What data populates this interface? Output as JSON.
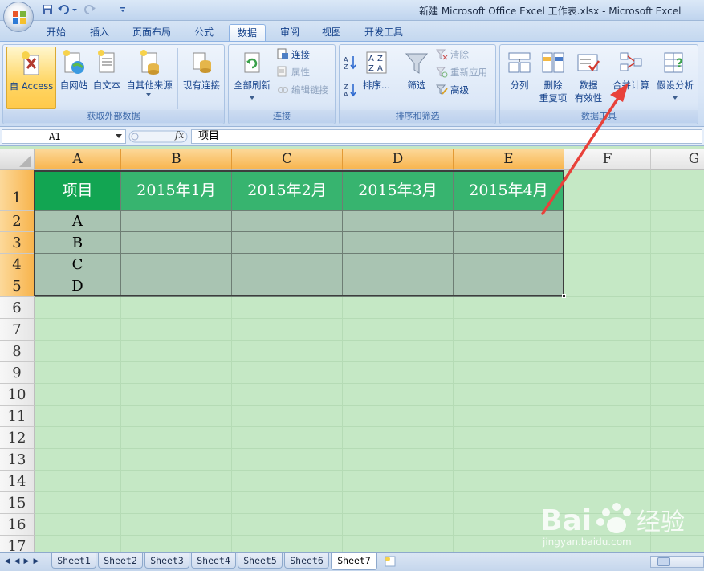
{
  "window": {
    "title": "新建 Microsoft Office Excel 工作表.xlsx - Microsoft Excel"
  },
  "tabs": [
    {
      "label": "开始",
      "active": false
    },
    {
      "label": "插入",
      "active": false
    },
    {
      "label": "页面布局",
      "active": false
    },
    {
      "label": "公式",
      "active": false
    },
    {
      "label": "数据",
      "active": true
    },
    {
      "label": "审阅",
      "active": false
    },
    {
      "label": "视图",
      "active": false
    },
    {
      "label": "开发工具",
      "active": false
    }
  ],
  "ribbon": {
    "get_external": {
      "label": "获取外部数据",
      "access": "自 Access",
      "web": "自网站",
      "text": "自文本",
      "other": "自其他来源",
      "existing": "现有连接"
    },
    "connections": {
      "label": "连接",
      "refresh_all": "全部刷新",
      "connections": "连接",
      "properties": "属性",
      "edit_links": "编辑链接"
    },
    "sort_filter": {
      "label": "排序和筛选",
      "sort": "排序...",
      "filter": "筛选",
      "clear": "清除",
      "reapply": "重新应用",
      "advanced": "高级"
    },
    "data_tools": {
      "label": "数据工具",
      "text_to_columns": "分列",
      "remove_dup_1": "删除",
      "remove_dup_2": "重复项",
      "validation_1": "数据",
      "validation_2": "有效性",
      "consolidate": "合并计算",
      "what_if": "假设分析"
    }
  },
  "formula_bar": {
    "name_box": "A1",
    "fx": "fx",
    "value": "项目"
  },
  "columns": [
    "A",
    "B",
    "C",
    "D",
    "E",
    "F",
    "G"
  ],
  "rows": [
    "1",
    "2",
    "3",
    "4",
    "5",
    "6",
    "7",
    "8",
    "9",
    "10",
    "11",
    "12",
    "13",
    "14",
    "15",
    "16",
    "17"
  ],
  "table": {
    "header": [
      "项目",
      "2015年1月",
      "2015年2月",
      "2015年3月",
      "2015年4月"
    ],
    "items": [
      "A",
      "B",
      "C",
      "D"
    ]
  },
  "sheets": [
    "Sheet1",
    "Sheet2",
    "Sheet3",
    "Sheet4",
    "Sheet5",
    "Sheet6",
    "Sheet7"
  ],
  "active_sheet": "Sheet7",
  "watermark": {
    "text": "jingyan.baidu.com",
    "logo_text": "Baidu经验"
  },
  "colors": {
    "annotation_arrow": "#e8413a",
    "header_green": "#37b46f",
    "header_first": "#12a552",
    "body_cell": "#a9c4b2",
    "sheet_bg": "#c5e8c5"
  }
}
